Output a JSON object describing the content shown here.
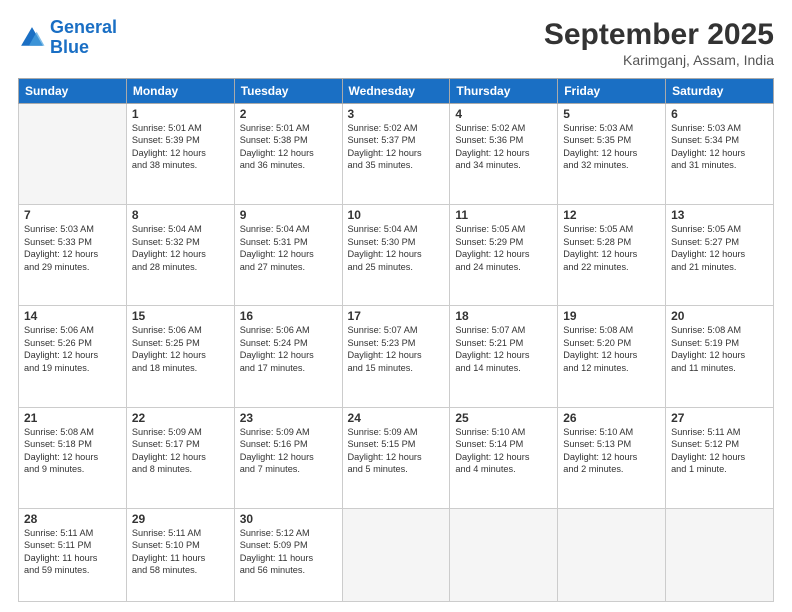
{
  "logo": {
    "line1": "General",
    "line2": "Blue"
  },
  "header": {
    "month": "September 2025",
    "location": "Karimganj, Assam, India"
  },
  "weekdays": [
    "Sunday",
    "Monday",
    "Tuesday",
    "Wednesday",
    "Thursday",
    "Friday",
    "Saturday"
  ],
  "weeks": [
    [
      {
        "day": "",
        "info": ""
      },
      {
        "day": "1",
        "info": "Sunrise: 5:01 AM\nSunset: 5:39 PM\nDaylight: 12 hours\nand 38 minutes."
      },
      {
        "day": "2",
        "info": "Sunrise: 5:01 AM\nSunset: 5:38 PM\nDaylight: 12 hours\nand 36 minutes."
      },
      {
        "day": "3",
        "info": "Sunrise: 5:02 AM\nSunset: 5:37 PM\nDaylight: 12 hours\nand 35 minutes."
      },
      {
        "day": "4",
        "info": "Sunrise: 5:02 AM\nSunset: 5:36 PM\nDaylight: 12 hours\nand 34 minutes."
      },
      {
        "day": "5",
        "info": "Sunrise: 5:03 AM\nSunset: 5:35 PM\nDaylight: 12 hours\nand 32 minutes."
      },
      {
        "day": "6",
        "info": "Sunrise: 5:03 AM\nSunset: 5:34 PM\nDaylight: 12 hours\nand 31 minutes."
      }
    ],
    [
      {
        "day": "7",
        "info": "Sunrise: 5:03 AM\nSunset: 5:33 PM\nDaylight: 12 hours\nand 29 minutes."
      },
      {
        "day": "8",
        "info": "Sunrise: 5:04 AM\nSunset: 5:32 PM\nDaylight: 12 hours\nand 28 minutes."
      },
      {
        "day": "9",
        "info": "Sunrise: 5:04 AM\nSunset: 5:31 PM\nDaylight: 12 hours\nand 27 minutes."
      },
      {
        "day": "10",
        "info": "Sunrise: 5:04 AM\nSunset: 5:30 PM\nDaylight: 12 hours\nand 25 minutes."
      },
      {
        "day": "11",
        "info": "Sunrise: 5:05 AM\nSunset: 5:29 PM\nDaylight: 12 hours\nand 24 minutes."
      },
      {
        "day": "12",
        "info": "Sunrise: 5:05 AM\nSunset: 5:28 PM\nDaylight: 12 hours\nand 22 minutes."
      },
      {
        "day": "13",
        "info": "Sunrise: 5:05 AM\nSunset: 5:27 PM\nDaylight: 12 hours\nand 21 minutes."
      }
    ],
    [
      {
        "day": "14",
        "info": "Sunrise: 5:06 AM\nSunset: 5:26 PM\nDaylight: 12 hours\nand 19 minutes."
      },
      {
        "day": "15",
        "info": "Sunrise: 5:06 AM\nSunset: 5:25 PM\nDaylight: 12 hours\nand 18 minutes."
      },
      {
        "day": "16",
        "info": "Sunrise: 5:06 AM\nSunset: 5:24 PM\nDaylight: 12 hours\nand 17 minutes."
      },
      {
        "day": "17",
        "info": "Sunrise: 5:07 AM\nSunset: 5:23 PM\nDaylight: 12 hours\nand 15 minutes."
      },
      {
        "day": "18",
        "info": "Sunrise: 5:07 AM\nSunset: 5:21 PM\nDaylight: 12 hours\nand 14 minutes."
      },
      {
        "day": "19",
        "info": "Sunrise: 5:08 AM\nSunset: 5:20 PM\nDaylight: 12 hours\nand 12 minutes."
      },
      {
        "day": "20",
        "info": "Sunrise: 5:08 AM\nSunset: 5:19 PM\nDaylight: 12 hours\nand 11 minutes."
      }
    ],
    [
      {
        "day": "21",
        "info": "Sunrise: 5:08 AM\nSunset: 5:18 PM\nDaylight: 12 hours\nand 9 minutes."
      },
      {
        "day": "22",
        "info": "Sunrise: 5:09 AM\nSunset: 5:17 PM\nDaylight: 12 hours\nand 8 minutes."
      },
      {
        "day": "23",
        "info": "Sunrise: 5:09 AM\nSunset: 5:16 PM\nDaylight: 12 hours\nand 7 minutes."
      },
      {
        "day": "24",
        "info": "Sunrise: 5:09 AM\nSunset: 5:15 PM\nDaylight: 12 hours\nand 5 minutes."
      },
      {
        "day": "25",
        "info": "Sunrise: 5:10 AM\nSunset: 5:14 PM\nDaylight: 12 hours\nand 4 minutes."
      },
      {
        "day": "26",
        "info": "Sunrise: 5:10 AM\nSunset: 5:13 PM\nDaylight: 12 hours\nand 2 minutes."
      },
      {
        "day": "27",
        "info": "Sunrise: 5:11 AM\nSunset: 5:12 PM\nDaylight: 12 hours\nand 1 minute."
      }
    ],
    [
      {
        "day": "28",
        "info": "Sunrise: 5:11 AM\nSunset: 5:11 PM\nDaylight: 11 hours\nand 59 minutes."
      },
      {
        "day": "29",
        "info": "Sunrise: 5:11 AM\nSunset: 5:10 PM\nDaylight: 11 hours\nand 58 minutes."
      },
      {
        "day": "30",
        "info": "Sunrise: 5:12 AM\nSunset: 5:09 PM\nDaylight: 11 hours\nand 56 minutes."
      },
      {
        "day": "",
        "info": ""
      },
      {
        "day": "",
        "info": ""
      },
      {
        "day": "",
        "info": ""
      },
      {
        "day": "",
        "info": ""
      }
    ]
  ]
}
